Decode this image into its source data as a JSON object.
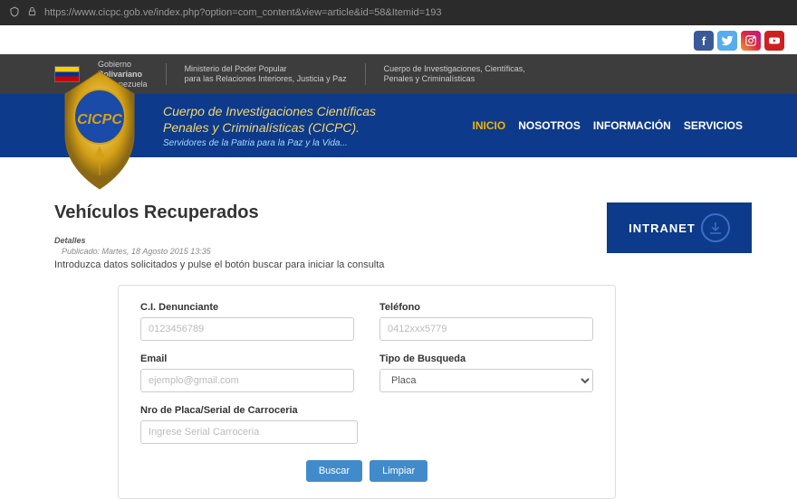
{
  "browser": {
    "url": "https://www.cicpc.gob.ve/index.php?option=com_content&view=article&id=58&Itemid=193"
  },
  "gov": {
    "line1": "Gobierno",
    "line2": "Bolivariano",
    "line3": "de Venezuela",
    "min1": "Ministerio del Poder Popular",
    "min2": "para las Relaciones Interiores, Justicia y Paz",
    "dept1": "Cuerpo de Investigaciones, Científicas,",
    "dept2": "Penales y Criminalísticas"
  },
  "header": {
    "title1": "Cuerpo de Investigaciones Científicas",
    "title2": "Penales y Criminalísticas (CICPC).",
    "slogan": "Servidores de la Patria para la Paz y la Vida..."
  },
  "nav": {
    "inicio": "INICIO",
    "nosotros": "NOSOTROS",
    "informacion": "INFORMACIÓN",
    "servicios": "SERVICIOS"
  },
  "page": {
    "title": "Vehículos Recuperados",
    "details": "Detalles",
    "published": "Publicado: Martes, 18 Agosto 2015 13:35",
    "intro": "Introduzca datos solicitados y pulse el botón buscar para iniciar la consulta"
  },
  "form": {
    "ci_label": "C.I. Denunciante",
    "ci_placeholder": "0123456789",
    "tel_label": "Teléfono",
    "tel_placeholder": "0412xxx5779",
    "email_label": "Email",
    "email_placeholder": "ejemplo@gmail.com",
    "tipo_label": "Tipo de Busqueda",
    "tipo_value": "Placa",
    "placa_label": "Nro de Placa/Serial de Carroceria",
    "placa_placeholder": "Ingrese Serial Carroceria",
    "buscar": "Buscar",
    "limpiar": "Limpiar"
  },
  "sidebar": {
    "intranet": "INTRANET"
  }
}
